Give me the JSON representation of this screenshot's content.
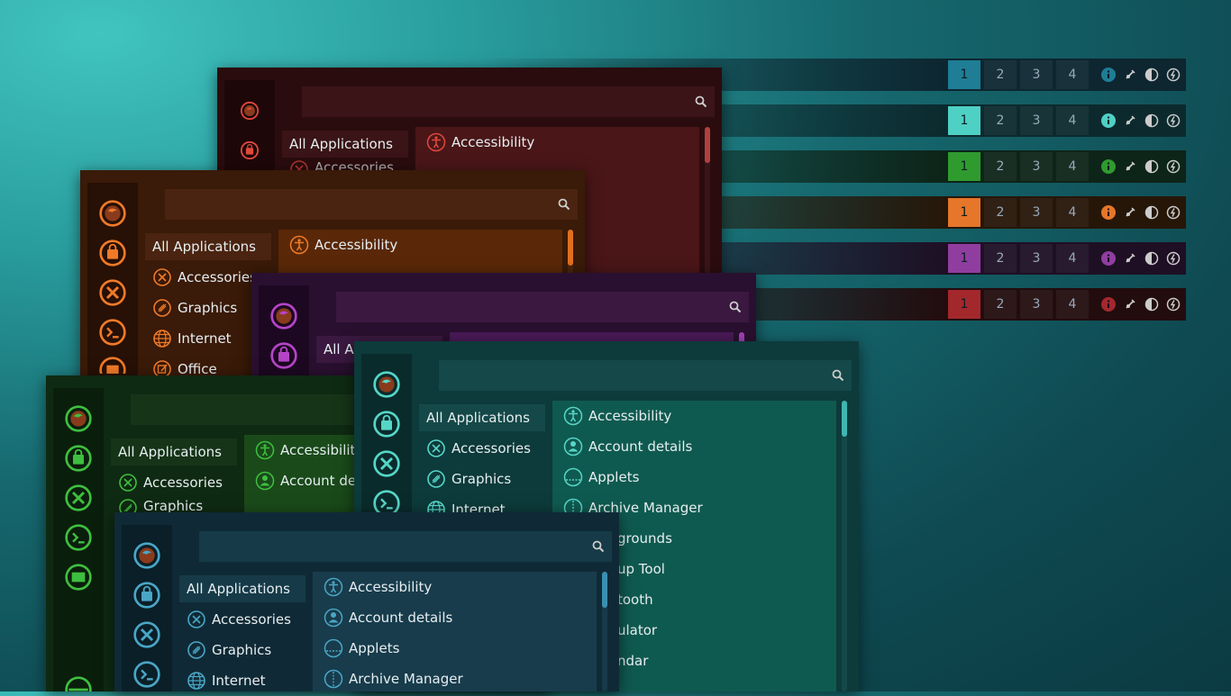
{
  "workspaces": [
    "1",
    "2",
    "3",
    "4"
  ],
  "bars": [
    {
      "theme": "blue",
      "accent": "#1f7d96",
      "bg": "#0d2630"
    },
    {
      "theme": "teal",
      "accent": "#4fd0c4",
      "bg": "#0c2a2e"
    },
    {
      "theme": "green",
      "accent": "#2f9b2f",
      "bg": "#0d2418"
    },
    {
      "theme": "orange",
      "accent": "#e5762a",
      "bg": "#261608"
    },
    {
      "theme": "purple",
      "accent": "#8f3ea0",
      "bg": "#1e0f24"
    },
    {
      "theme": "red",
      "accent": "#a3282c",
      "bg": "#220c0e"
    }
  ],
  "bar_icons": [
    "info-icon",
    "network-icon",
    "volume-icon",
    "power-icon"
  ],
  "menu": {
    "categories": [
      "All Applications",
      "Accessories",
      "Graphics",
      "Internet",
      "Office"
    ],
    "apps": [
      "Accessibility",
      "Account details",
      "Applets",
      "Archive Manager"
    ],
    "teal_partial_apps": [
      "grounds",
      "up Tool",
      "tooth",
      "ulator",
      "ndar"
    ],
    "red_partial_category": "Accessories",
    "purple_partial_category": "All Ap",
    "green_partial_apps": [
      "Accessibility",
      "Account det"
    ],
    "green_partial_category": "Graphics"
  },
  "colors": {
    "red": "#e0483e",
    "orange": "#f07a28",
    "purple": "#b545c8",
    "green": "#3fbf3f",
    "teal": "#56d6c8",
    "blue": "#4aa6c6"
  }
}
